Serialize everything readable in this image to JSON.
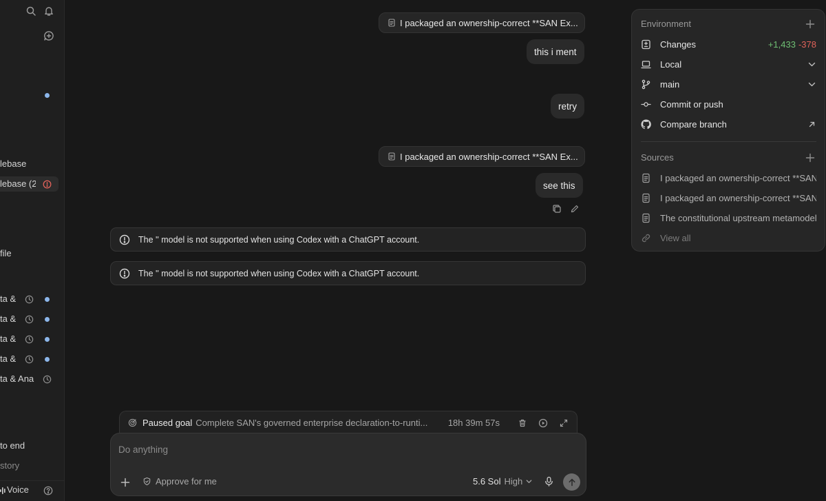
{
  "sidebar": {
    "items": [
      {
        "label": "lebase"
      },
      {
        "label": "lebase (2"
      },
      {
        "label": "file"
      },
      {
        "label": "ta &"
      },
      {
        "label": "ta &"
      },
      {
        "label": "ta &"
      },
      {
        "label": "ta &"
      },
      {
        "label": "ta & Ana"
      },
      {
        "label": "to end"
      },
      {
        "label": "story"
      }
    ],
    "voice_label": "Voice"
  },
  "chat": {
    "messages": [
      {
        "type": "attachment",
        "text": "I packaged an ownership-correct **SAN Ex..."
      },
      {
        "type": "user",
        "text": "this i ment"
      },
      {
        "type": "user",
        "text": "retry"
      },
      {
        "type": "attachment",
        "text": "I packaged an ownership-correct **SAN Ex..."
      },
      {
        "type": "user",
        "text": "see this"
      }
    ],
    "errors": [
      "The '' model is not supported when using Codex with a ChatGPT account.",
      "The '' model is not supported when using Codex with a ChatGPT account."
    ]
  },
  "goal": {
    "label": "Paused goal",
    "text": "Complete SAN's governed enterprise declaration-to-runti...",
    "time": "18h 39m 57s"
  },
  "composer": {
    "placeholder": "Do anything",
    "approve_label": "Approve for me",
    "model": "5.6 Sol",
    "effort": "High"
  },
  "panel": {
    "environment_title": "Environment",
    "changes_label": "Changes",
    "additions": "+1,433",
    "deletions": "-378",
    "location": "Local",
    "branch": "main",
    "commit_label": "Commit or push",
    "compare_label": "Compare branch",
    "sources_title": "Sources",
    "sources": [
      "I packaged an ownership-correct **SAN Ex",
      "I packaged an ownership-correct **SAN Ex",
      "The constitutional upstream metamodel"
    ],
    "view_all": "View all"
  },
  "colors": {
    "background": "#181818",
    "additions": "#6fbf73",
    "deletions": "#e0625a",
    "unread_dot": "#8cb6ea",
    "error_icon": "#e0625a"
  }
}
